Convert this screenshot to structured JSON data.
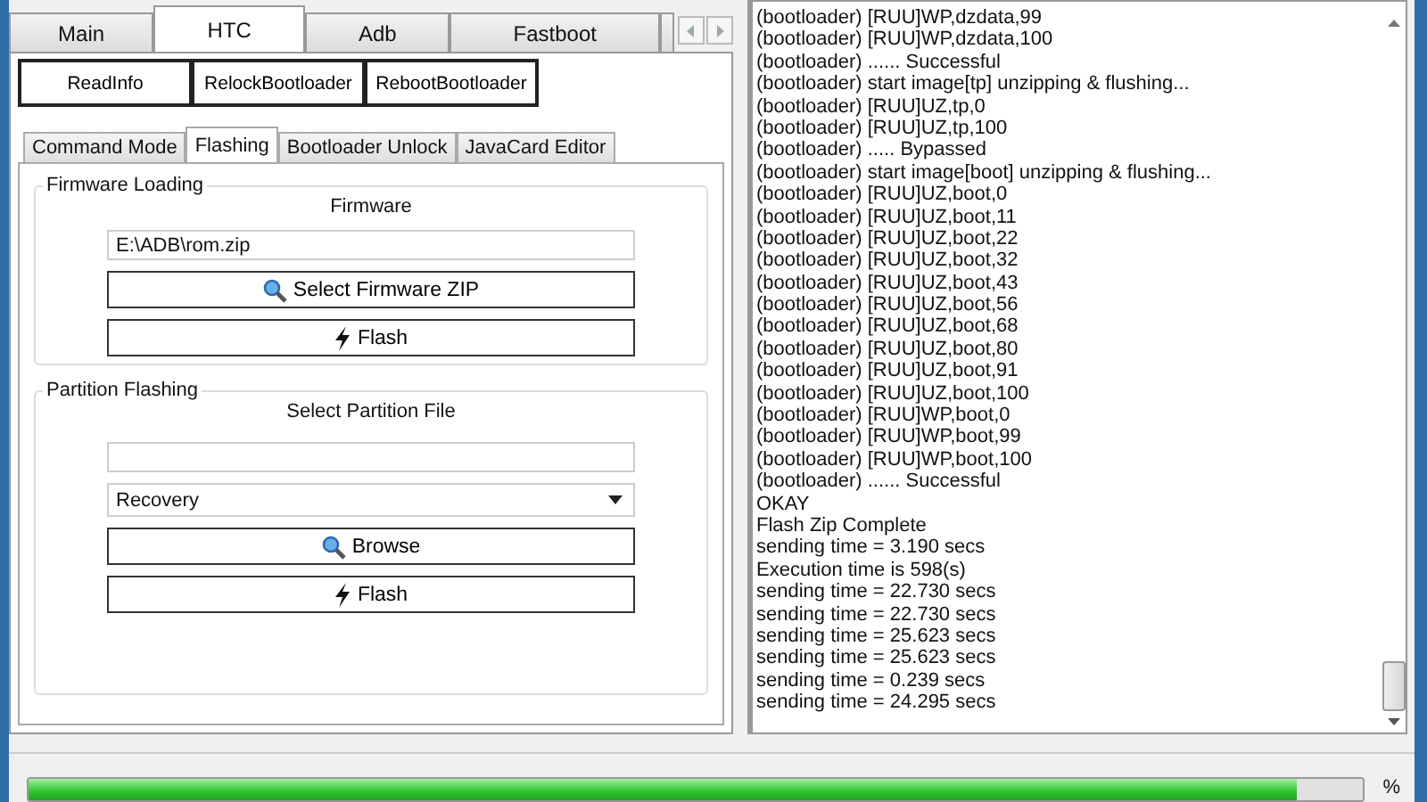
{
  "main_tabs": [
    {
      "label": "Main",
      "selected": false
    },
    {
      "label": "HTC",
      "selected": true
    },
    {
      "label": "Adb",
      "selected": false
    },
    {
      "label": "Fastboot",
      "selected": false
    }
  ],
  "actions": [
    "ReadInfo",
    "RelockBootloader",
    "RebootBootloader"
  ],
  "sub_tabs": [
    {
      "label": "Command Mode",
      "selected": false
    },
    {
      "label": "Flashing",
      "selected": true
    },
    {
      "label": "Bootloader Unlock",
      "selected": false
    },
    {
      "label": "JavaCard Editor",
      "selected": false
    }
  ],
  "firmware_group": {
    "title": "Firmware Loading",
    "label": "Firmware",
    "path": "E:\\ADB\\rom.zip",
    "select_button": "Select Firmware ZIP",
    "flash_button": "Flash"
  },
  "partition_group": {
    "title": "Partition Flashing",
    "label": "Select Partition File",
    "partition": "Recovery",
    "browse_button": "Browse",
    "flash_button": "Flash"
  },
  "log": [
    "(bootloader) [RUU]WP,dzdata,99",
    "(bootloader) [RUU]WP,dzdata,100",
    "(bootloader) ...... Successful",
    "(bootloader) start image[tp] unzipping & flushing...",
    "(bootloader) [RUU]UZ,tp,0",
    "(bootloader) [RUU]UZ,tp,100",
    "(bootloader) ..... Bypassed",
    "(bootloader) start image[boot] unzipping & flushing...",
    "(bootloader) [RUU]UZ,boot,0",
    "(bootloader) [RUU]UZ,boot,11",
    "(bootloader) [RUU]UZ,boot,22",
    "(bootloader) [RUU]UZ,boot,32",
    "(bootloader) [RUU]UZ,boot,43",
    "(bootloader) [RUU]UZ,boot,56",
    "(bootloader) [RUU]UZ,boot,68",
    "(bootloader) [RUU]UZ,boot,80",
    "(bootloader) [RUU]UZ,boot,91",
    "(bootloader) [RUU]UZ,boot,100",
    "(bootloader) [RUU]WP,boot,0",
    "(bootloader) [RUU]WP,boot,99",
    "(bootloader) [RUU]WP,boot,100",
    "(bootloader) ...... Successful",
    "OKAY",
    "Flash Zip Complete",
    "sending time = 3.190 secs",
    "Execution time is 598(s)",
    "sending time = 22.730 secs",
    "sending time = 22.730 secs",
    "sending time = 25.623 secs",
    "sending time = 25.623 secs",
    "sending time = 0.239 secs",
    "sending time = 24.295 secs"
  ],
  "progress": {
    "level": 0.95,
    "unit": "%"
  }
}
